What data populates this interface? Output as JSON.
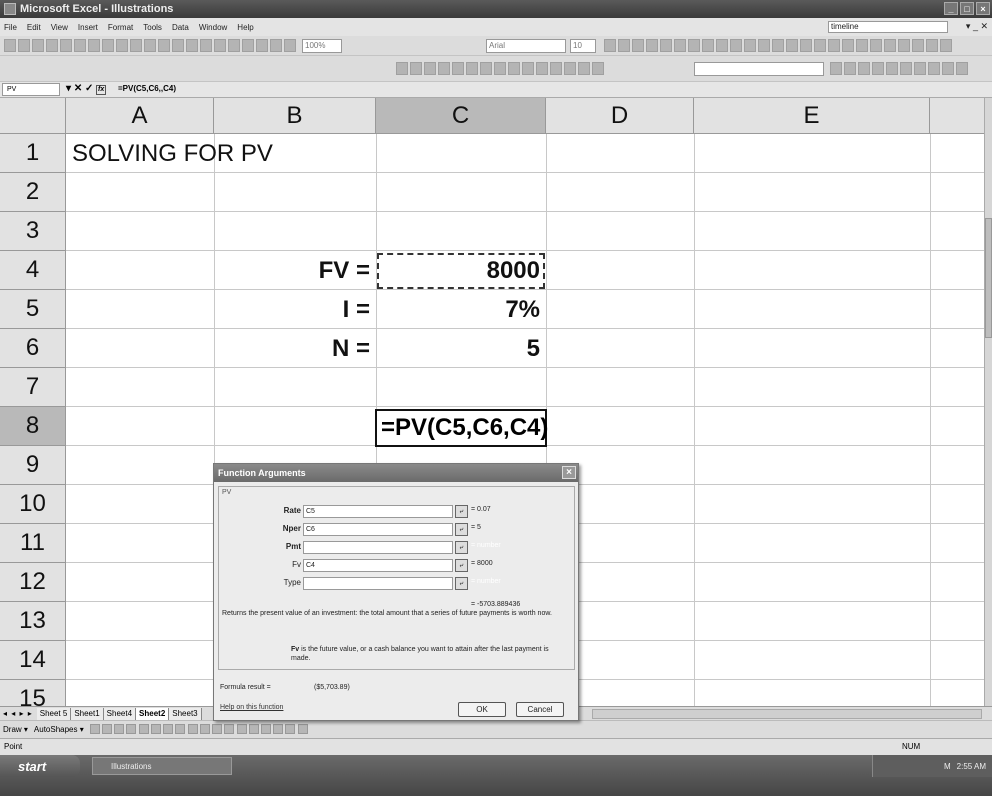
{
  "window": {
    "title": "Microsoft Excel - Illustrations"
  },
  "menu": {
    "items": [
      "File",
      "Edit",
      "View",
      "Insert",
      "Format",
      "Tools",
      "Data",
      "Window",
      "Help"
    ],
    "ask_box": "timeline"
  },
  "toolbar": {
    "zoom": "100%",
    "font": "Arial",
    "font_size": "10"
  },
  "formula_bar": {
    "name_box": "PV",
    "cancel_symbol": "✕",
    "enter_symbol": "✓",
    "fx_label": "fx",
    "formula": "=PV(C5,C6,,C4)"
  },
  "grid": {
    "columns": [
      "A",
      "B",
      "C",
      "D",
      "E"
    ],
    "rows": [
      "1",
      "2",
      "3",
      "4",
      "5",
      "6",
      "7",
      "8",
      "9",
      "10",
      "11",
      "12",
      "13",
      "14",
      "15"
    ],
    "title": "SOLVING FOR PV",
    "labels": {
      "fv": "FV =",
      "i": "I =",
      "n": "N ="
    },
    "values": {
      "c4": "8000",
      "c5": "7%",
      "c6": "5"
    },
    "edit_cell": "=PV(C5,C6,C4)"
  },
  "sheet_tabs": {
    "nav": "◂ ◂ ▸ ▸",
    "tabs": [
      "Sheet 5",
      "Sheet1",
      "Sheet4",
      "Sheet2",
      "Sheet3"
    ],
    "active": "Sheet2"
  },
  "drawing_toolbar": {
    "draw": "Draw ▾",
    "autoshapes": "AutoShapes ▾"
  },
  "status_bar": {
    "mode": "Point",
    "num": "NUM"
  },
  "taskbar": {
    "start": "start",
    "item": "Illustrations",
    "time": "2:55 AM",
    "tray_letter": "M"
  },
  "dialog": {
    "title": "Function Arguments",
    "close": "×",
    "group_label": "PV",
    "args": [
      {
        "label": "Rate",
        "value": "C5",
        "result": "= 0.07",
        "result_muted": false
      },
      {
        "label": "Nper",
        "value": "C6",
        "result": "= 5",
        "result_muted": false
      },
      {
        "label": "Pmt",
        "value": "",
        "result": "= number",
        "result_muted": true
      },
      {
        "label": "Fv",
        "value": "C4",
        "result": "= 8000",
        "result_muted": false
      },
      {
        "label": "Type",
        "value": "",
        "result": "= number",
        "result_muted": true
      }
    ],
    "ref_button": "⤶",
    "total": "= -5703.889436",
    "description": "Returns the present value of an investment: the total amount that a series of future payments is worth now.",
    "arg_help_name": "Fv",
    "arg_help_text": "is the future value, or a cash balance you want to attain after the last payment is made.",
    "formula_result_label": "Formula result =",
    "formula_result_value": "($5,703.89)",
    "help_link": "Help on this function",
    "ok": "OK",
    "cancel": "Cancel"
  }
}
